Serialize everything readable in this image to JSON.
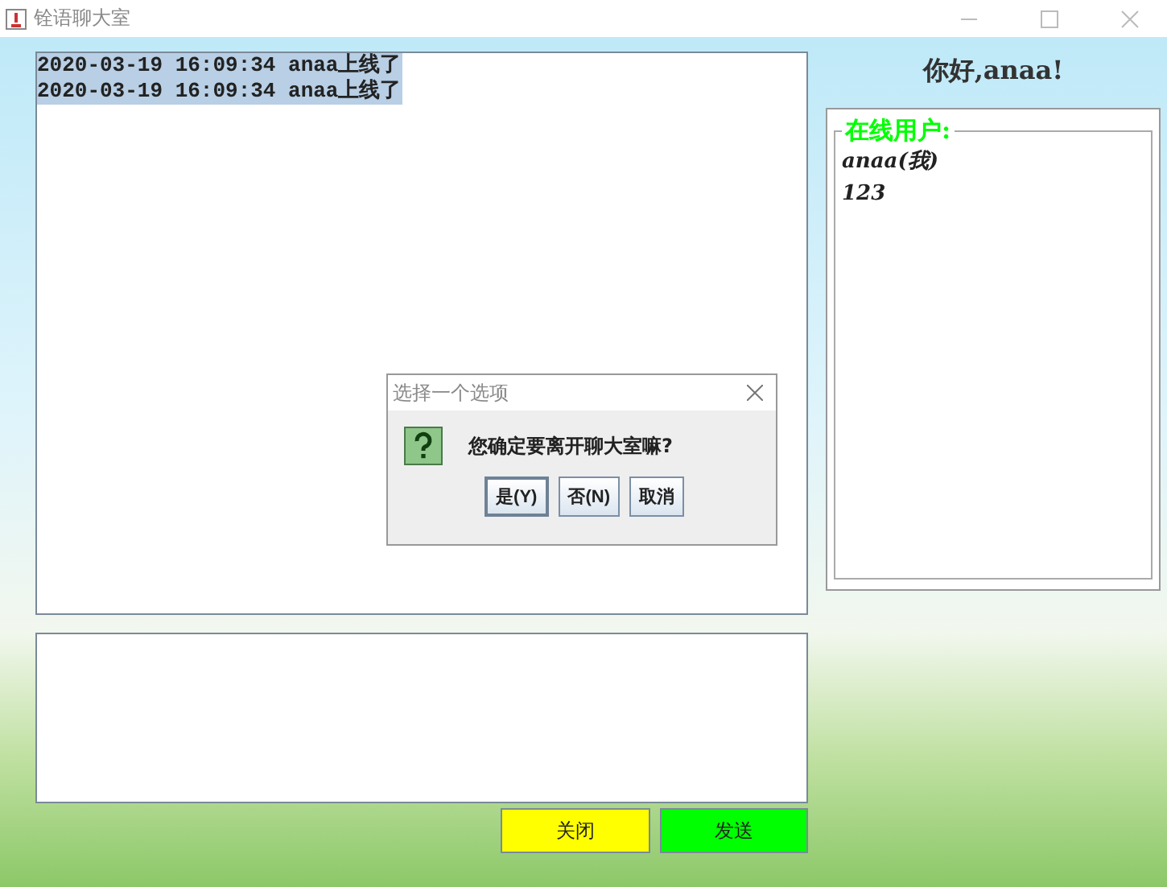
{
  "window": {
    "title": "铨语聊大室"
  },
  "messages": [
    "2020-03-19 16:09:34 anaa上线了",
    "2020-03-19 16:09:34 anaa上线了"
  ],
  "buttons": [
    {
      "kind": "close",
      "label": "关闭"
    },
    {
      "kind": "send",
      "label": "发送"
    }
  ],
  "greeting": "你好,anaa!",
  "online_panel": {
    "title": "在线用户:",
    "users": [
      "anaa(我)",
      "123"
    ]
  },
  "dialog": {
    "title": "选择一个选项",
    "message": "您确定要离开聊大室嘛?",
    "buttons": [
      {
        "label": "是(Y)",
        "selected": true
      },
      {
        "label": "否(N)",
        "selected": false
      },
      {
        "label": "取消",
        "selected": false
      }
    ]
  }
}
